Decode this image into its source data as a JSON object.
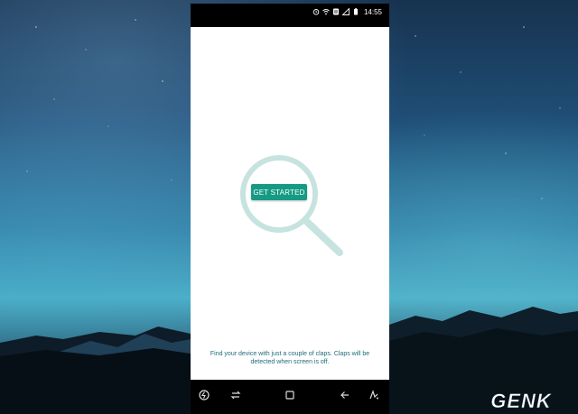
{
  "status_bar": {
    "time": "14:55",
    "icons": [
      "alarm-icon",
      "wifi-icon",
      "data-icon",
      "signal-icon",
      "battery-icon"
    ]
  },
  "app": {
    "get_started_label": "GET STARTED",
    "info_text": "Find your device with just a couple of claps. Claps will be detected when screen is off.",
    "accent_color": "#159a85"
  },
  "nav_bar": {
    "buttons": [
      "power-save-icon",
      "recent-apps-icon",
      "home-icon",
      "back-icon",
      "assistant-icon"
    ]
  },
  "watermark": {
    "text": "GENK"
  }
}
